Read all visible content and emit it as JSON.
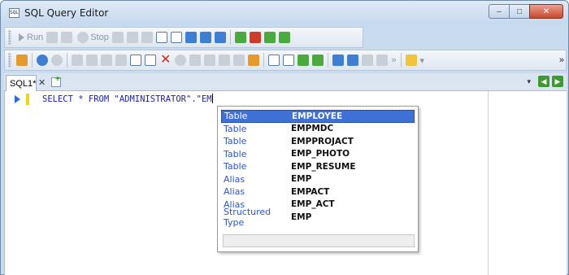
{
  "window": {
    "title": "SQL Query Editor",
    "app_icon_text": "SQL",
    "controls": {
      "minimize": "–",
      "maximize": "□",
      "close": "✕"
    }
  },
  "toolbar1": {
    "run_label": "Run",
    "stop_label": "Stop"
  },
  "toolbar2": {
    "overflow": "»"
  },
  "tabs": [
    {
      "label": "SQL1*",
      "close": "✕"
    }
  ],
  "tabnav": {
    "dropdown": "▾",
    "prev": "◀",
    "next": "▶"
  },
  "editor": {
    "code": "SELECT * FROM \"ADMINISTRATOR\".\"EM"
  },
  "autocomplete": {
    "items": [
      {
        "kind": "Table",
        "name": "EMPLOYEE",
        "selected": true
      },
      {
        "kind": "Table",
        "name": "EMPMDC"
      },
      {
        "kind": "Table",
        "name": "EMPPROJACT"
      },
      {
        "kind": "Table",
        "name": "EMP_PHOTO"
      },
      {
        "kind": "Table",
        "name": "EMP_RESUME"
      },
      {
        "kind": "Alias",
        "name": "EMP"
      },
      {
        "kind": "Alias",
        "name": "EMPACT"
      },
      {
        "kind": "Alias",
        "name": "EMP_ACT"
      },
      {
        "kind": "Structured Type",
        "name": "EMP"
      }
    ],
    "status": ""
  },
  "colors": {
    "selection": "#3f70d6",
    "kind_text": "#2b55d6",
    "code_text": "#1b1bb3",
    "change_bar": "#f0d40f"
  }
}
